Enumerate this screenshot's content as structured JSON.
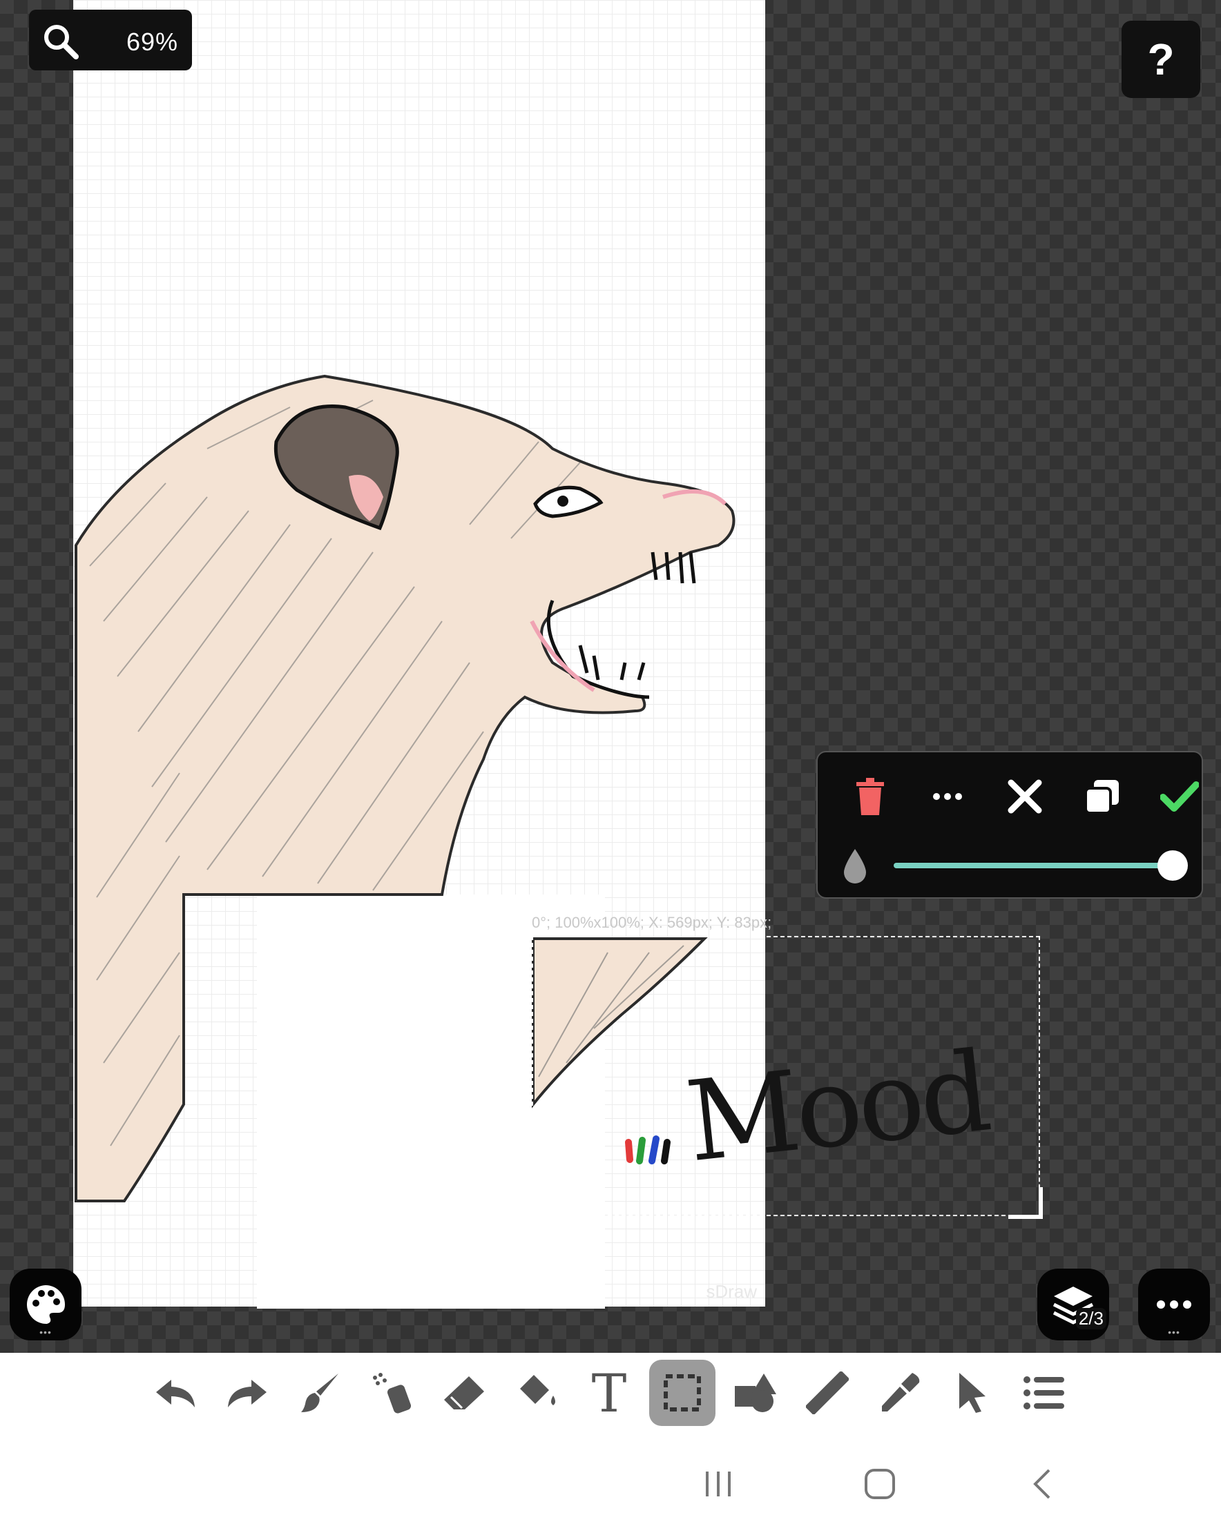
{
  "app": {
    "name": "sDraw"
  },
  "zoom": {
    "level": "69%",
    "icon": "magnifier-icon"
  },
  "help": {
    "label": "?"
  },
  "canvas": {
    "watermark": "sDraw"
  },
  "selection": {
    "info": "0°; 100%x100%; X: 569px; Y: 83px;"
  },
  "artwork": {
    "caption": "Mood"
  },
  "selection_toolbar": {
    "icons": [
      "trash-icon",
      "more-icon",
      "close-icon",
      "duplicate-icon",
      "check-icon"
    ],
    "opacity_icon": "drop-icon",
    "opacity_value": 1.0,
    "colors": {
      "trash": "#f26363",
      "check": "#4cd964",
      "slider": "#7ad1c2"
    }
  },
  "layers": {
    "count_label": "2/3",
    "icon": "layers-icon"
  },
  "palette": {
    "icon": "palette-icon"
  },
  "more_menu": {
    "icon": "more-icon"
  },
  "tools": [
    {
      "name": "undo-icon"
    },
    {
      "name": "redo-icon"
    },
    {
      "name": "brush-icon"
    },
    {
      "name": "spray-icon"
    },
    {
      "name": "eraser-icon"
    },
    {
      "name": "fill-bucket-icon"
    },
    {
      "name": "text-tool-icon",
      "glyph": "T"
    },
    {
      "name": "select-rect-icon",
      "active": true
    },
    {
      "name": "shapes-icon"
    },
    {
      "name": "ruler-icon"
    },
    {
      "name": "eyedropper-icon"
    },
    {
      "name": "pointer-icon"
    },
    {
      "name": "list-icon"
    }
  ],
  "nav": [
    "recents-icon",
    "home-icon",
    "back-icon"
  ]
}
